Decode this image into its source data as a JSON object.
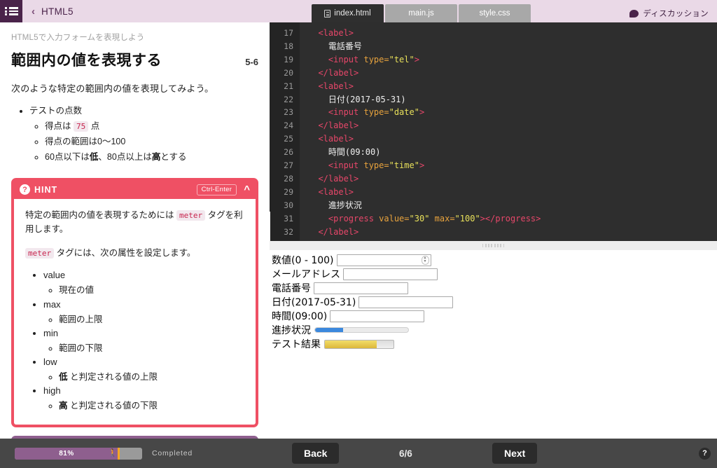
{
  "header": {
    "menu_icon": "hamburger-list-icon",
    "back_chevron": "‹",
    "course_title": "HTML5"
  },
  "lesson": {
    "subtitle": "HTML5で入力フォームを表現しよう",
    "title": "範囲内の値を表現する",
    "number": "5-6",
    "intro": "次のような特定の範囲内の値を表現してみよう。",
    "bullets": [
      {
        "label": "テストの点数",
        "sub": [
          "得点は 75 点",
          "得点の範囲は0〜100",
          "60点以下は低、80点以上は高とする"
        ],
        "sub_code": "75",
        "sub_pre": "得点は",
        "sub_post": "点"
      }
    ],
    "score_value": "75",
    "score_pre": "得点は",
    "score_post": "点",
    "range_line": "得点の範囲は0〜100",
    "threshold_pre": "60点以下は",
    "threshold_low": "低",
    "threshold_mid": "、80点以上は",
    "threshold_high": "高",
    "threshold_post": "とする"
  },
  "hint": {
    "icon": "question-mark-icon",
    "label": "HINT",
    "shortcut": "Ctrl-Enter",
    "collapse_icon": "chevron-up-icon",
    "para1_pre": "特定の範囲内の値を表現するためには",
    "para1_code": "meter",
    "para1_post": "タグを利用します。",
    "para2_code": "meter",
    "para2_post": "タグには、次の属性を設定します。",
    "attributes": [
      {
        "name": "value",
        "desc": "現在の値",
        "desc_pre": "",
        "desc_bold": "",
        "desc_post": "現在の値"
      },
      {
        "name": "max",
        "desc": "範囲の上限",
        "desc_pre": "",
        "desc_bold": "",
        "desc_post": "範囲の上限"
      },
      {
        "name": "min",
        "desc": "範囲の下限",
        "desc_pre": "",
        "desc_bold": "",
        "desc_post": "範囲の下限"
      },
      {
        "name": "low",
        "desc": "低 と判定される値の上限",
        "desc_pre": "",
        "desc_bold": "低",
        "desc_post": " と判定される値の上限"
      },
      {
        "name": "high",
        "desc": "高 と判定される値の下限",
        "desc_pre": "",
        "desc_bold": "高",
        "desc_post": " と判定される値の下限"
      }
    ]
  },
  "editor": {
    "tabs": [
      {
        "label": "index.html",
        "active": true,
        "icon": "file-icon"
      },
      {
        "label": "main.js",
        "active": false
      },
      {
        "label": "style.css",
        "active": false
      }
    ],
    "discussion": {
      "label": "ディスカッション",
      "icon": "speech-bubble-icon"
    },
    "first_line_number": 17,
    "lines": [
      {
        "n": "17",
        "indent": 2,
        "parts": [
          {
            "t": "tag",
            "s": "<label>"
          }
        ]
      },
      {
        "n": "18",
        "indent": 4,
        "parts": [
          {
            "t": "txt",
            "s": "電話番号"
          }
        ]
      },
      {
        "n": "19",
        "indent": 4,
        "parts": [
          {
            "t": "tag",
            "s": "<input "
          },
          {
            "t": "attr",
            "s": "type="
          },
          {
            "t": "str",
            "s": "\"tel\""
          },
          {
            "t": "tag",
            "s": ">"
          }
        ]
      },
      {
        "n": "20",
        "indent": 2,
        "parts": [
          {
            "t": "tag",
            "s": "</label>"
          }
        ]
      },
      {
        "n": "21",
        "indent": 2,
        "parts": [
          {
            "t": "tag",
            "s": "<label>"
          }
        ]
      },
      {
        "n": "22",
        "indent": 4,
        "parts": [
          {
            "t": "txt",
            "s": "日付(2017-05-31)"
          }
        ]
      },
      {
        "n": "23",
        "indent": 4,
        "parts": [
          {
            "t": "tag",
            "s": "<input "
          },
          {
            "t": "attr",
            "s": "type="
          },
          {
            "t": "str",
            "s": "\"date\""
          },
          {
            "t": "tag",
            "s": ">"
          }
        ]
      },
      {
        "n": "24",
        "indent": 2,
        "parts": [
          {
            "t": "tag",
            "s": "</label>"
          }
        ]
      },
      {
        "n": "25",
        "indent": 2,
        "parts": [
          {
            "t": "tag",
            "s": "<label>"
          }
        ]
      },
      {
        "n": "26",
        "indent": 4,
        "parts": [
          {
            "t": "txt",
            "s": "時間(09:00)"
          }
        ]
      },
      {
        "n": "27",
        "indent": 4,
        "parts": [
          {
            "t": "tag",
            "s": "<input "
          },
          {
            "t": "attr",
            "s": "type="
          },
          {
            "t": "str",
            "s": "\"time\""
          },
          {
            "t": "tag",
            "s": ">"
          }
        ]
      },
      {
        "n": "28",
        "indent": 2,
        "parts": [
          {
            "t": "tag",
            "s": "</label>"
          }
        ]
      },
      {
        "n": "29",
        "indent": 2,
        "parts": [
          {
            "t": "tag",
            "s": "<label>"
          }
        ]
      },
      {
        "n": "30",
        "indent": 4,
        "parts": [
          {
            "t": "txt",
            "s": "進捗状況"
          }
        ]
      },
      {
        "n": "31",
        "indent": 4,
        "parts": [
          {
            "t": "tag",
            "s": "<progress "
          },
          {
            "t": "attr",
            "s": "value="
          },
          {
            "t": "str",
            "s": "\"30\""
          },
          {
            "t": "attr",
            "s": " max="
          },
          {
            "t": "str",
            "s": "\"100\""
          },
          {
            "t": "tag",
            "s": "></progress>"
          }
        ]
      },
      {
        "n": "32",
        "indent": 2,
        "parts": [
          {
            "t": "tag",
            "s": "</label>"
          }
        ]
      }
    ]
  },
  "preview": {
    "rows": [
      {
        "label": "数値(0 - 100)",
        "control": "number",
        "value": ""
      },
      {
        "label": "メールアドレス",
        "control": "text",
        "value": ""
      },
      {
        "label": "電話番号",
        "control": "text",
        "value": ""
      },
      {
        "label": "日付(2017-05-31)",
        "control": "text",
        "value": ""
      },
      {
        "label": "時間(09:00)",
        "control": "text",
        "value": ""
      },
      {
        "label": "進捗状況",
        "control": "progress",
        "value": 30,
        "max": 100
      },
      {
        "label": "テスト結果",
        "control": "meter",
        "value": 75,
        "max": 100
      }
    ]
  },
  "bottom": {
    "progress_percent": "81%",
    "progress_value": 81,
    "runner_icon": "runner-icon",
    "completed_label": "Completed",
    "back_label": "Back",
    "page_indicator": "6/6",
    "next_label": "Next",
    "help_label": "?"
  },
  "colors": {
    "brand_purple": "#4a234a",
    "header_bg": "#ead9e7",
    "hint_red": "#ef5064",
    "progress_purple": "#8e5f8e",
    "progress_marker": "#f6a623",
    "editor_bg": "#2e2e2e",
    "bottom_bar": "#474747",
    "preview_progress": "#3b88dd",
    "preview_meter": "#dcb83a"
  }
}
